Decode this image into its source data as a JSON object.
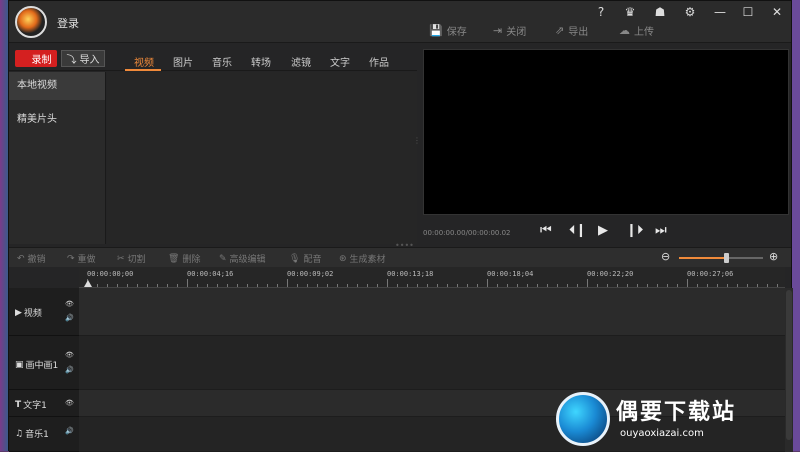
{
  "titlebar": {
    "login": "登录",
    "window_controls": [
      "?",
      "♛",
      "☗",
      "⚙",
      "—",
      "☐",
      "✕"
    ],
    "actions": [
      {
        "icon": "save-icon",
        "glyph": "💾",
        "label": "保存"
      },
      {
        "icon": "close-icon",
        "glyph": "⇥",
        "label": "关闭"
      },
      {
        "icon": "export-icon",
        "glyph": "⇗",
        "label": "导出"
      },
      {
        "icon": "upload-icon",
        "glyph": "☁",
        "label": "上传"
      }
    ]
  },
  "library": {
    "record_label": "录制",
    "import_label": "导入",
    "tabs": [
      "视频",
      "图片",
      "音乐",
      "转场",
      "滤镜",
      "文字",
      "作品"
    ],
    "active_tab": "视频",
    "sidebar": [
      "本地视频",
      "精美片头"
    ]
  },
  "preview": {
    "time": "00:00:00.00/00:00:00.02"
  },
  "edit_toolbar": [
    "撤销",
    "重做",
    "切割",
    "删除",
    "高级编辑",
    "配音",
    "生成素材"
  ],
  "zoom_level_fraction": 0.56,
  "ruler": {
    "labels": [
      "00:00:00;00",
      "00:00:04;16",
      "00:00:09;02",
      "00:00:13;18",
      "00:00:18;04",
      "00:00:22;20",
      "00:00:27;06",
      "00:0"
    ]
  },
  "tracks": [
    {
      "name": "视频",
      "glyph": "▶"
    },
    {
      "name": "画中画1",
      "glyph": "▣"
    },
    {
      "name": "文字1",
      "glyph": "T"
    },
    {
      "name": "音乐1",
      "glyph": "♫"
    }
  ],
  "watermark": {
    "title": "偶要下载站",
    "subtitle": "ouyaoxiazai.com"
  },
  "colors": {
    "accent": "#f08a3a",
    "record": "#d42020"
  }
}
